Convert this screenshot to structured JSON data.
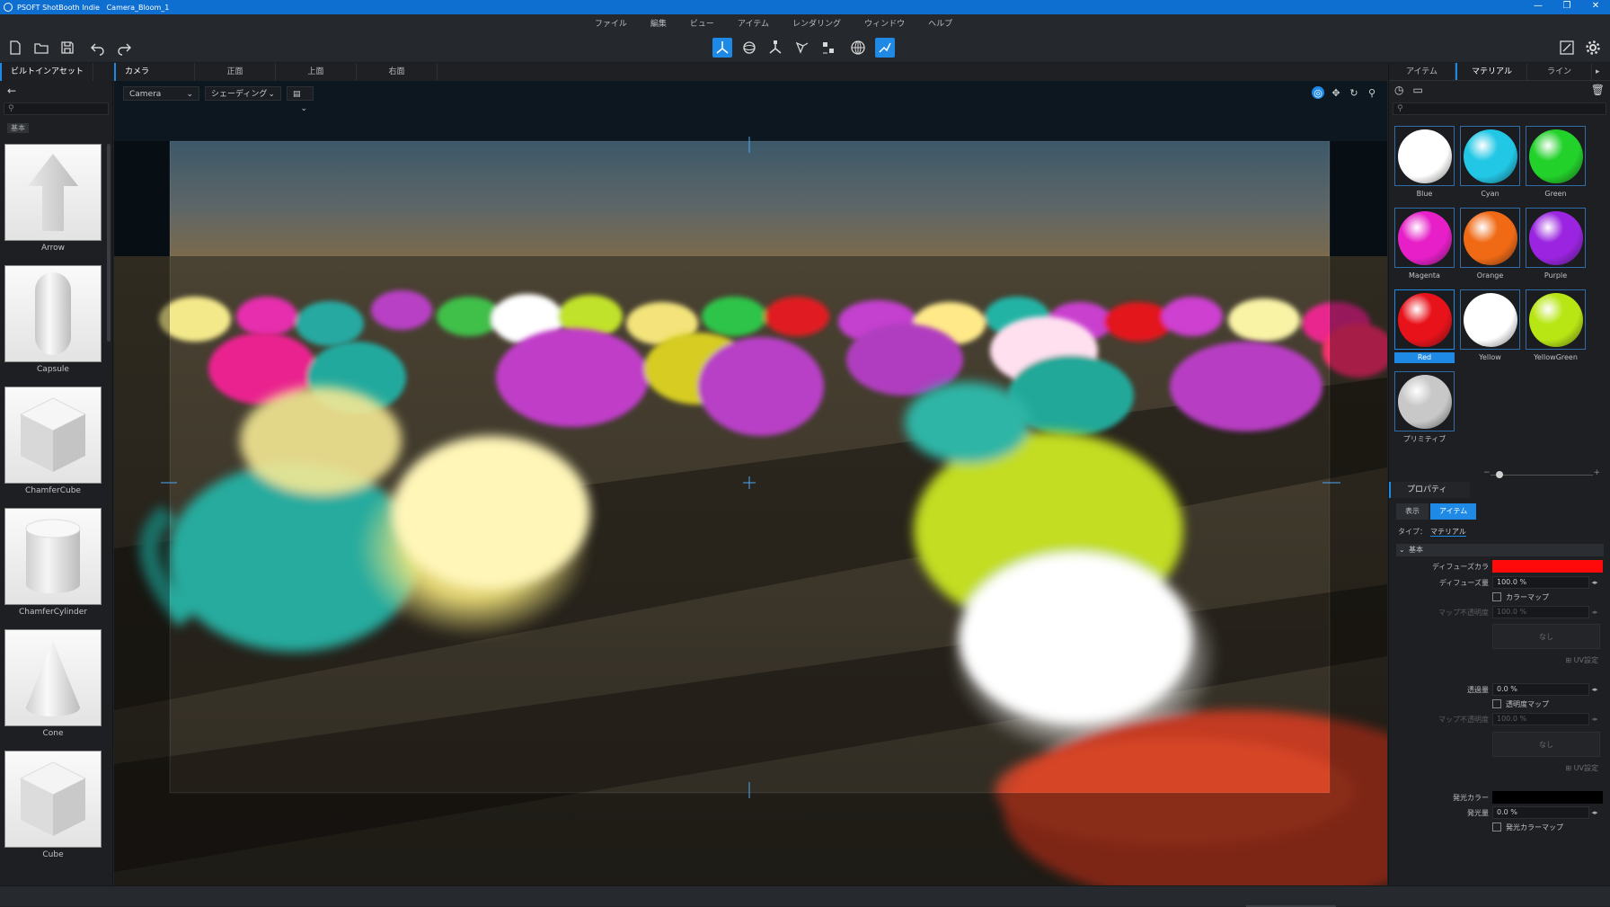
{
  "titlebar": {
    "title": "PSOFT ShotBooth Indie   Camera_Bloom_1",
    "minimize": "—",
    "maximize": "❐",
    "close": "✕"
  },
  "menu": [
    "ファイル",
    "編集",
    "ビュー",
    "アイテム",
    "レンダリング",
    "ウィンドウ",
    "ヘルプ"
  ],
  "left_tab": "ビルトインアセット",
  "view_tabs": [
    "カメラ",
    "正面",
    "上面",
    "右面"
  ],
  "assets": [
    "Arrow",
    "Capsule",
    "ChamferCube",
    "ChamferCylinder",
    "Cone",
    "Cube"
  ],
  "left_chip": "基本",
  "viewport": {
    "camera": "Camera",
    "shading": "シェーディング"
  },
  "right_tabs": [
    "アイテム",
    "マテリアル",
    "ライン"
  ],
  "materials": [
    {
      "label": "Blue",
      "color": "#ffffff"
    },
    {
      "label": "Cyan",
      "color": "#22c7e6"
    },
    {
      "label": "Green",
      "color": "#22d12a"
    },
    {
      "label": "Magenta",
      "color": "#e61fc8"
    },
    {
      "label": "Orange",
      "color": "#f06a16"
    },
    {
      "label": "Purple",
      "color": "#9a24e0"
    },
    {
      "label": "Red",
      "color": "#e8121a"
    },
    {
      "label": "Yellow",
      "color": "#ffffff"
    },
    {
      "label": "YellowGreen",
      "color": "#b8e614"
    },
    {
      "label": "プリミティブ",
      "color": "#c8c8c8"
    }
  ],
  "props": {
    "tab": "プロパティ",
    "sub_tabs": [
      "表示",
      "アイテム"
    ],
    "type_label": "タイプ：",
    "type_value": "マテリアル",
    "section": "基本",
    "diffuse_color_label": "ディフューズカラ",
    "diffuse_color": "#ff0a0a",
    "diffuse_amount_label": "ディフューズ量",
    "diffuse_amount": "100.0 %",
    "color_map": "カラーマップ",
    "map_opacity_label": "マップ不透明度",
    "map_opacity": "100.0 %",
    "none": "なし",
    "uv": "UV設定",
    "transparency_label": "透過量",
    "transparency": "0.0 %",
    "transparency_map": "透明度マップ",
    "map_opacity2": "100.0 %",
    "emission_color_label": "発光カラー",
    "emission_color": "#000000",
    "emission_amount_label": "発光量",
    "emission_amount": "0.0 %",
    "emission_map": "発光カラーマップ"
  }
}
